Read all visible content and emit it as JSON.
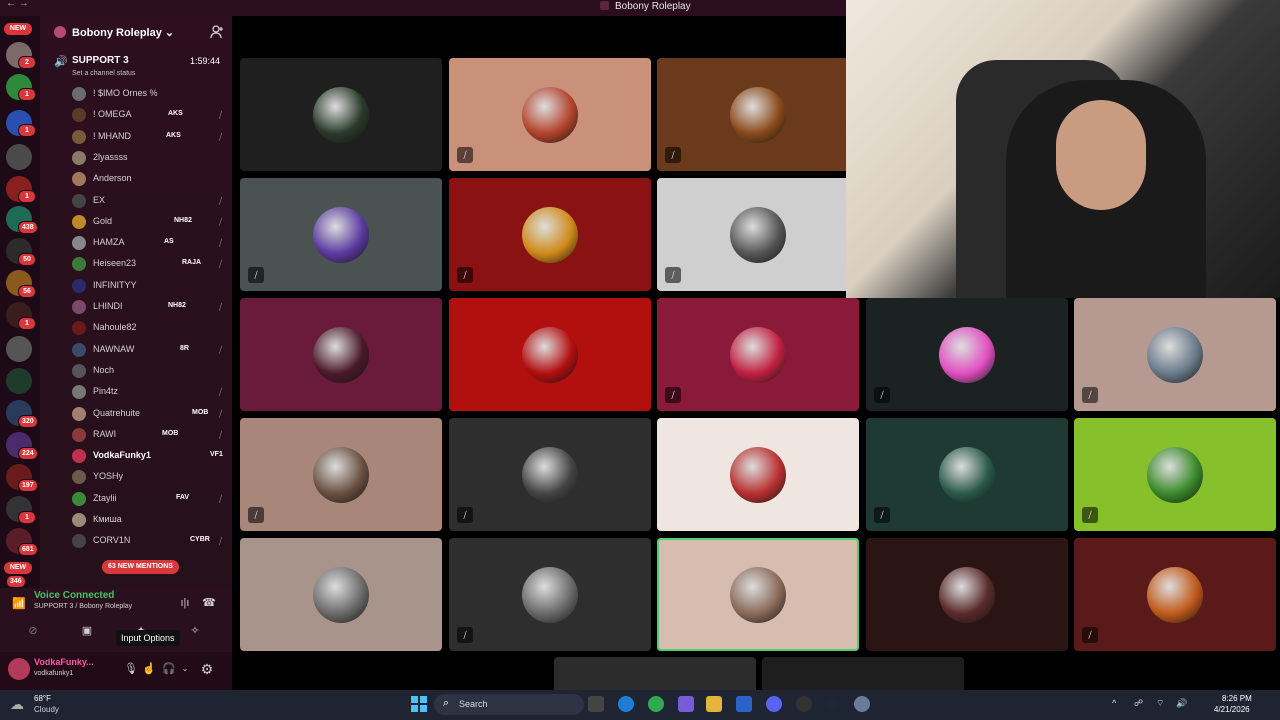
{
  "window": {
    "title": "Bobony Roleplay"
  },
  "server_rail": {
    "new_top": "NEW",
    "new_bottom": "NEW",
    "badges": [
      "2",
      "1",
      "1",
      "1",
      "438",
      "50",
      "56",
      "1",
      "320",
      "224",
      "197",
      "1",
      "681",
      "346"
    ]
  },
  "guild": {
    "name": "Bobony Roleplay"
  },
  "voice_channel": {
    "name": "SUPPORT 3",
    "timer": "1:59:44",
    "status_prompt": "Set a channel status"
  },
  "members": [
    {
      "name": "! $IMO Ornes %",
      "tag": ""
    },
    {
      "name": "! OMEGA",
      "tag": "AKS"
    },
    {
      "name": "! MHAND",
      "tag": "AKS"
    },
    {
      "name": "2lyassss",
      "tag": ""
    },
    {
      "name": "Anderson",
      "tag": ""
    },
    {
      "name": "EX",
      "tag": ""
    },
    {
      "name": "Gold",
      "tag": "NH82"
    },
    {
      "name": "HAMZA",
      "tag": "AS"
    },
    {
      "name": "Heiseen23",
      "tag": "RAJA"
    },
    {
      "name": "INFINITYY",
      "tag": ""
    },
    {
      "name": "LHINDI",
      "tag": "NH82"
    },
    {
      "name": "Nahoule82",
      "tag": ""
    },
    {
      "name": "NAWNAW",
      "tag": "8R"
    },
    {
      "name": "Noch",
      "tag": ""
    },
    {
      "name": "Pin4tz",
      "tag": ""
    },
    {
      "name": "Quatrehuite",
      "tag": "MOB"
    },
    {
      "name": "RAWI",
      "tag": "MOB"
    },
    {
      "name": "VodkaFunky1",
      "tag": "VF1"
    },
    {
      "name": "YOSHy",
      "tag": ""
    },
    {
      "name": "Ztaylii",
      "tag": "FAV"
    },
    {
      "name": "Кмиша",
      "tag": ""
    },
    {
      "name": "CORV1N",
      "tag": "CYBR"
    }
  ],
  "mentions_pill": "63 NEW MENTIONS",
  "voice_panel": {
    "connected": "Voice Connected",
    "channel": "SUPPORT 3 / Bobony Roleplay"
  },
  "tooltip": "Input Options",
  "user": {
    "display": "VodkaFunky...",
    "handle": "vodkafunky1"
  },
  "taskbar": {
    "temp": "68°F",
    "condition": "Cloudy",
    "search": "Search",
    "time": "8:26 PM",
    "date": "4/21/2026"
  },
  "colors": {
    "accent_green": "#43c463",
    "mention_red": "#da373c",
    "sidebar": "#2d0f1f",
    "stage": "#000000"
  }
}
